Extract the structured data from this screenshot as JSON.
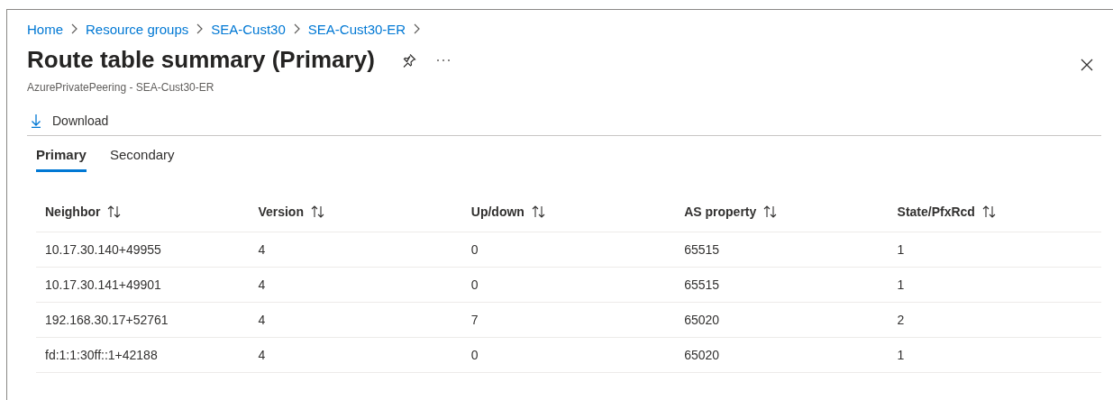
{
  "breadcrumb": [
    "Home",
    "Resource groups",
    "SEA-Cust30",
    "SEA-Cust30-ER"
  ],
  "title": "Route table summary (Primary)",
  "subtitle": "AzurePrivatePeering - SEA-Cust30-ER",
  "toolbar": {
    "download": "Download"
  },
  "tabs": [
    {
      "label": "Primary",
      "selected": true
    },
    {
      "label": "Secondary",
      "selected": false
    }
  ],
  "table": {
    "columns": [
      "Neighbor",
      "Version",
      "Up/down",
      "AS property",
      "State/PfxRcd"
    ],
    "rows": [
      [
        "10.17.30.140+49955",
        "4",
        "0",
        "65515",
        "1"
      ],
      [
        "10.17.30.141+49901",
        "4",
        "0",
        "65515",
        "1"
      ],
      [
        "192.168.30.17+52761",
        "4",
        "7",
        "65020",
        "2"
      ],
      [
        "fd:1:1:30ff::1+42188",
        "4",
        "0",
        "65020",
        "1"
      ]
    ]
  }
}
